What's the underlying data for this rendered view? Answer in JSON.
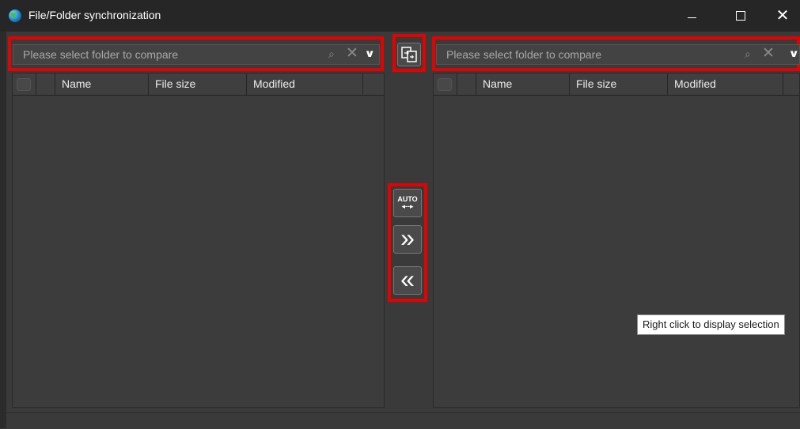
{
  "window": {
    "title": "File/Folder synchronization",
    "icon": "globe-icon",
    "controls": [
      "minimize-icon",
      "maximize-icon",
      "close-icon"
    ],
    "close_glyph": "✕"
  },
  "left": {
    "placeholder": "Please select folder to compare",
    "columns": [
      "Name",
      "File size",
      "Modified"
    ]
  },
  "right": {
    "placeholder": "Please select folder to compare",
    "columns": [
      "Name",
      "File size",
      "Modified"
    ]
  },
  "middle": {
    "compare_button_icon": "compare-folders-icon",
    "auto_label": "AUTO",
    "auto_arrows": "◂--▸",
    "sync_right_glyph": "»",
    "sync_left_glyph": "«"
  },
  "tooltip": "Right click to display selection",
  "colors": {
    "highlight": "#e60000",
    "background": "#3a3a3a",
    "titlebar": "#262626"
  }
}
